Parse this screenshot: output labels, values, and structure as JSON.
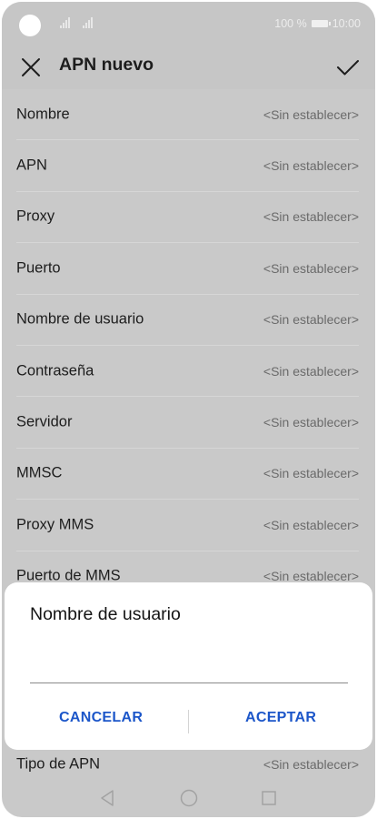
{
  "status_bar": {
    "battery_text": "100 %",
    "time": "10:00"
  },
  "app_bar": {
    "title": "APN nuevo",
    "close_icon": "close-icon",
    "confirm_icon": "check-icon"
  },
  "settings": {
    "placeholder": "<Sin establecer>",
    "rows": [
      {
        "label": "Nombre",
        "value": "<Sin establecer>"
      },
      {
        "label": "APN",
        "value": "<Sin establecer>"
      },
      {
        "label": "Proxy",
        "value": "<Sin establecer>"
      },
      {
        "label": "Puerto",
        "value": "<Sin establecer>"
      },
      {
        "label": "Nombre de usuario",
        "value": "<Sin establecer>"
      },
      {
        "label": "Contraseña",
        "value": "<Sin establecer>"
      },
      {
        "label": "Servidor",
        "value": "<Sin establecer>"
      },
      {
        "label": "MMSC",
        "value": "<Sin establecer>"
      },
      {
        "label": "Proxy MMS",
        "value": "<Sin establecer>"
      },
      {
        "label": "Puerto de MMS",
        "value": "<Sin establecer>"
      }
    ],
    "last_row": {
      "label": "Tipo de APN",
      "value": "<Sin establecer>"
    }
  },
  "dialog": {
    "title": "Nombre de usuario",
    "input_value": "",
    "cancel_label": "CANCELAR",
    "accept_label": "ACEPTAR",
    "accent_color": "#1c56c9"
  },
  "nav_bar": {
    "back_icon": "back-triangle-icon",
    "home_icon": "home-circle-icon",
    "recent_icon": "recent-square-icon"
  }
}
